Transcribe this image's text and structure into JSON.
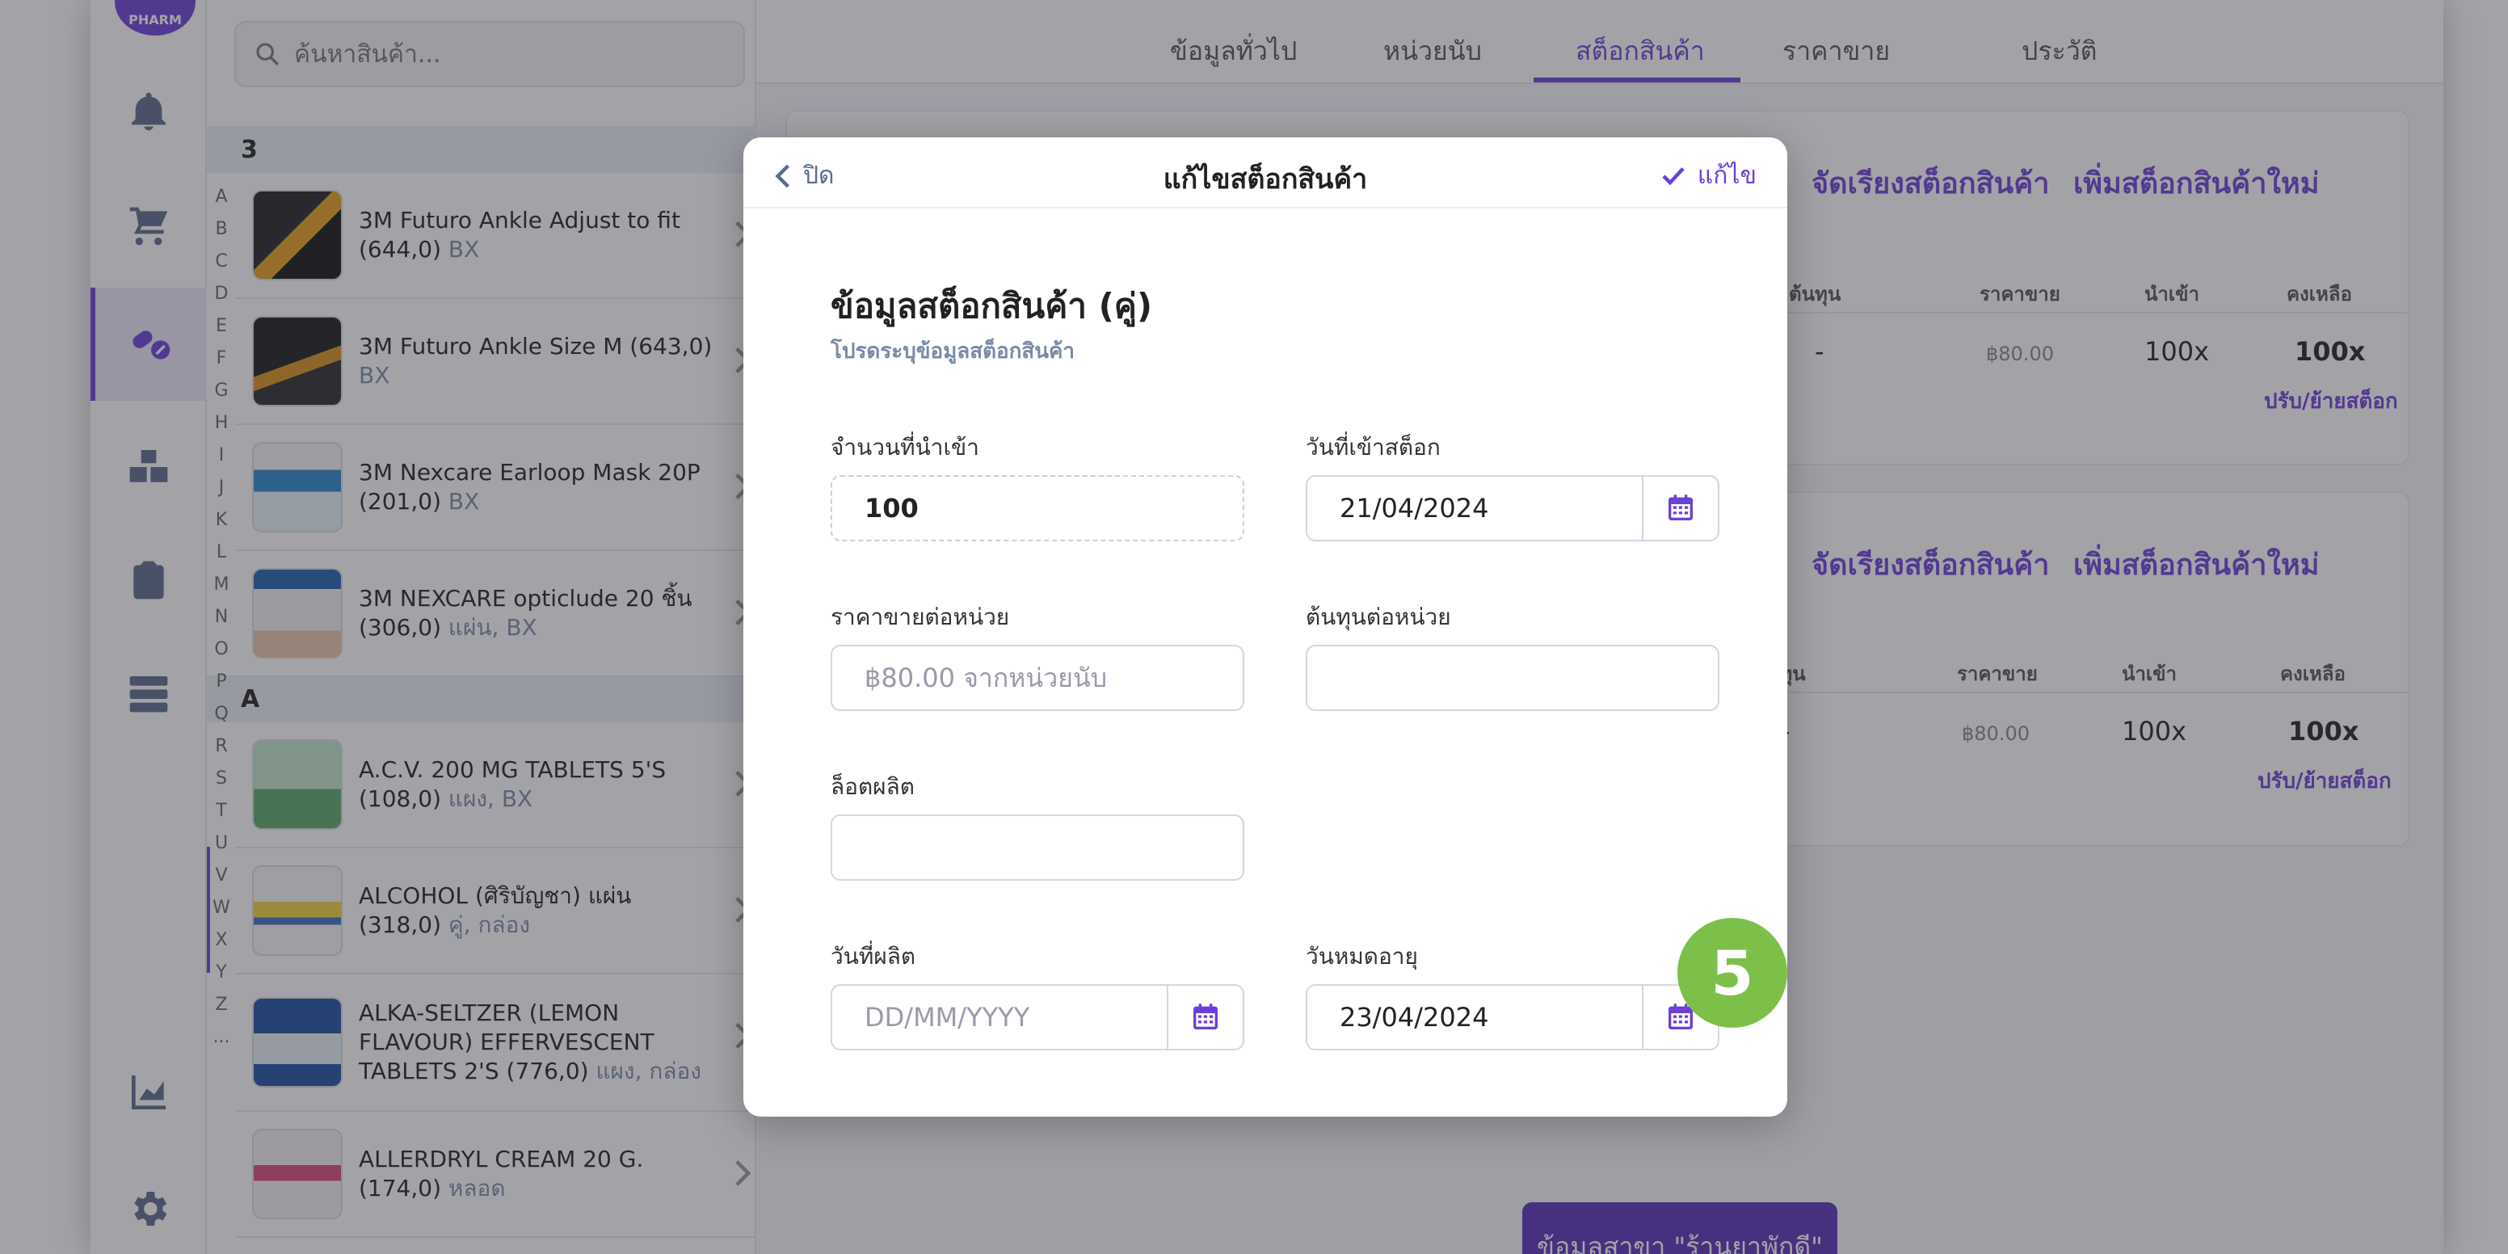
{
  "colors": {
    "accent": "#6c3fd6",
    "badge": "#7cc04a",
    "muted_label": "#7a8aa8"
  },
  "rail": {
    "avatar_text": "PHARM",
    "icons": [
      "bell-icon",
      "cart-icon",
      "pills-icon",
      "boxes-icon",
      "clipboard-icon",
      "server-icon",
      "chart-icon",
      "gear-icon"
    ],
    "active": "pills-icon"
  },
  "product_list": {
    "search_placeholder": "ค้นหาสินค้า...",
    "sections": [
      {
        "header": "3",
        "items": [
          {
            "name": "3M Futuro Ankle Adjust to fit (644,0)",
            "unit": "BX"
          },
          {
            "name": "3M Futuro Ankle Size M (643,0)",
            "unit": "BX"
          },
          {
            "name": "3M Nexcare Earloop Mask 20P (201,0)",
            "unit": "BX"
          },
          {
            "name": "3M NEXCARE opticlude 20 ชิ้น (306,0)",
            "unit": "แผ่น, BX"
          }
        ]
      },
      {
        "header": "A",
        "items": [
          {
            "name": "A.C.V. 200 MG TABLETS 5'S (108,0)",
            "unit": "แผง, BX"
          },
          {
            "name": "ALCOHOL (ศิริบัญชา) แผ่น (318,0)",
            "unit": "คู่, กล่อง"
          },
          {
            "name": "ALKA-SELTZER (LEMON FLAVOUR) EFFERVESCENT TABLETS 2'S (776,0)",
            "unit": "แผง, กล่อง"
          },
          {
            "name": "ALLERDRYL CREAM 20 G. (174,0)",
            "unit": "หลอด"
          }
        ]
      }
    ],
    "alphabet": [
      "A",
      "B",
      "C",
      "D",
      "E",
      "F",
      "G",
      "H",
      "I",
      "J",
      "K",
      "L",
      "M",
      "N",
      "O",
      "P",
      "Q",
      "R",
      "S",
      "T",
      "U",
      "V",
      "W",
      "X",
      "Y",
      "Z",
      "..."
    ]
  },
  "main": {
    "tabs": [
      "ข้อมูลทั่วไป",
      "หน่วยนับ",
      "สต็อกสินค้า",
      "ราคาขาย",
      "ประวัติ"
    ],
    "active_tab": "สต็อกสินค้า",
    "cards": [
      {
        "sort_link": "จัดเรียงสต็อกสินค้า",
        "add_link": "เพิ่มสต็อกสินค้าใหม่",
        "columns": [
          "ต้นทุน",
          "ราคาขาย",
          "นำเข้า",
          "คงเหลือ"
        ],
        "row": {
          "cost": "-",
          "price": "฿80.00",
          "imported": "100x",
          "remaining": "100x"
        },
        "adjust_link": "ปรับ/ย้ายสต็อก"
      },
      {
        "sort_link": "จัดเรียงสต็อกสินค้า",
        "add_link": "เพิ่มสต็อกสินค้าใหม่",
        "columns": [
          "นทุน",
          "ราคาขาย",
          "นำเข้า",
          "คงเหลือ"
        ],
        "row": {
          "cost": "-",
          "price": "฿80.00",
          "imported": "100x",
          "remaining": "100x"
        },
        "adjust_link": "ปรับ/ย้ายสต็อก"
      }
    ],
    "branch_button": "ข้อมูลสาขา \"ร้านยาพักดี\""
  },
  "modal": {
    "close_label": "ปิด",
    "title": "แก้ไขสต็อกสินค้า",
    "edit_label": "แก้ไข",
    "section_title": "ข้อมูลสต็อกสินค้า (คู่)",
    "section_subtitle": "โปรดระบุข้อมูลสต็อกสินค้า",
    "fields": {
      "import_qty": {
        "label": "จำนวนที่นำเข้า",
        "value": "100"
      },
      "stock_in_date": {
        "label": "วันที่เข้าสต็อก",
        "value": "21/04/2024"
      },
      "sell_price": {
        "label": "ราคาขายต่อหน่วย",
        "placeholder": "฿80.00 จากหน่วยนับ"
      },
      "unit_cost": {
        "label": "ต้นทุนต่อหน่วย",
        "value": ""
      },
      "lot": {
        "label": "ล็อตผลิต",
        "value": ""
      },
      "mfg_date": {
        "label": "วันที่ผลิต",
        "placeholder": "DD/MM/YYYY"
      },
      "exp_date": {
        "label": "วันหมดอายุ",
        "value": "23/04/2024"
      }
    }
  },
  "step_badge": "5"
}
